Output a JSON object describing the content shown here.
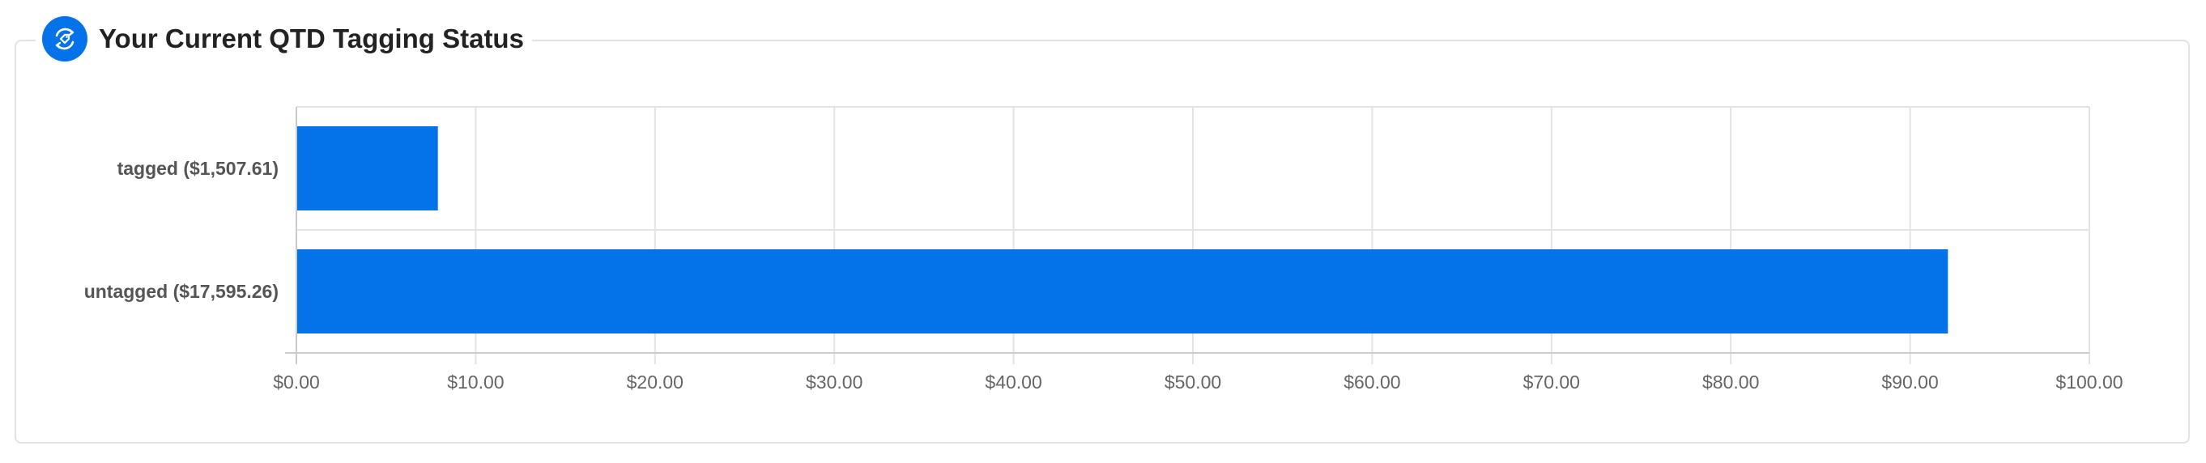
{
  "header": {
    "title": "Your Current QTD Tagging Status",
    "icon": "tag-refresh-icon"
  },
  "colors": {
    "bar": "#0473ea",
    "grid": "#e3e3e3",
    "axis": "#cccccc",
    "label": "#555555",
    "tick": "#666666"
  },
  "chart_data": {
    "type": "bar",
    "orientation": "horizontal",
    "categories": [
      "tagged ($1,507.61)",
      "untagged ($17,595.26)"
    ],
    "values": [
      7.89,
      92.11
    ],
    "xlim": [
      0,
      100
    ],
    "xticks": [
      0,
      10,
      20,
      30,
      40,
      50,
      60,
      70,
      80,
      90,
      100
    ],
    "xtick_labels": [
      "$0.00",
      "$10.00",
      "$20.00",
      "$30.00",
      "$40.00",
      "$50.00",
      "$60.00",
      "$70.00",
      "$80.00",
      "$90.00",
      "$100.00"
    ],
    "grid": true,
    "legend": "none"
  }
}
